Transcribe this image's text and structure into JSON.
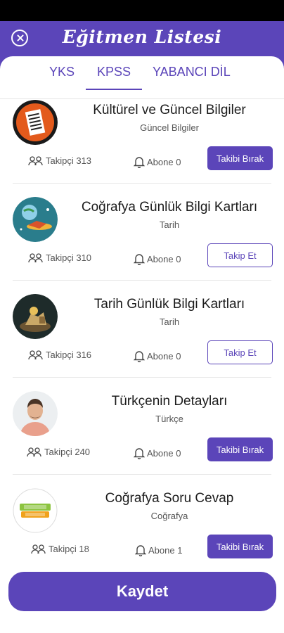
{
  "header": {
    "title": "Eğitmen Listesi",
    "close_icon": "close-icon"
  },
  "tabs": [
    {
      "label": "YKS",
      "active": false
    },
    {
      "label": "KPSS",
      "active": true
    },
    {
      "label": "YABANCI DİL",
      "active": false
    }
  ],
  "accent_color": "#5b45b9",
  "cards": [
    {
      "title": "Kültürel ve Güncel  Bilgiler",
      "subtitle": "Güncel Bilgiler",
      "followers": "Takipçi 313",
      "subscribers": "Abone 0",
      "button": "Takibi Bırak",
      "button_style": "filled",
      "avatar": "newspaper-logo"
    },
    {
      "title": "Coğrafya Günlük  Bilgi Kartları",
      "subtitle": "Tarih",
      "followers": "Takipçi 310",
      "subscribers": "Abone 0",
      "button": "Takip Et",
      "button_style": "outline",
      "avatar": "globe-space-logo"
    },
    {
      "title": "Tarih  Günlük Bilgi Kartları",
      "subtitle": "Tarih",
      "followers": "Takipçi 316",
      "subscribers": "Abone 0",
      "button": "Takip Et",
      "button_style": "outline",
      "avatar": "history-scene-logo"
    },
    {
      "title": "Türkçenin Detayları",
      "subtitle": "Türkçe",
      "followers": "Takipçi 240",
      "subscribers": "Abone 0",
      "button": "Takibi Bırak",
      "button_style": "filled",
      "avatar": "person-photo"
    },
    {
      "title": "Coğrafya Soru Cevap",
      "subtitle": "Coğrafya",
      "followers": "Takipçi 18",
      "subscribers": "Abone 1",
      "button": "Takibi Bırak",
      "button_style": "filled",
      "avatar": "quiz-logo"
    }
  ],
  "save_label": "Kaydet"
}
